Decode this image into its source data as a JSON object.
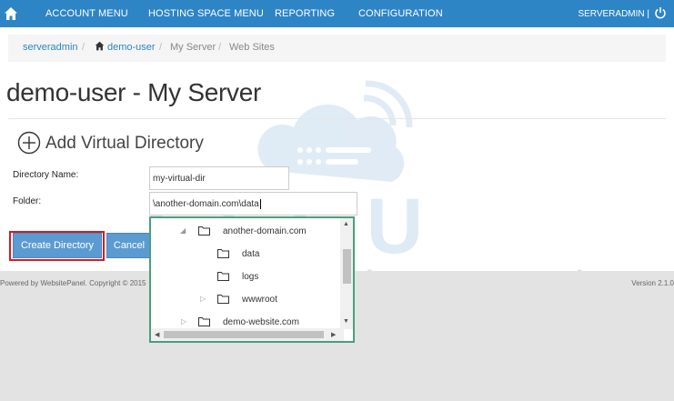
{
  "topnav": {
    "items": [
      "ACCOUNT MENU",
      "HOSTING SPACE MENU",
      "REPORTING",
      "CONFIGURATION"
    ],
    "user": "SERVERADMIN |"
  },
  "breadcrumb": {
    "root": "serveradmin",
    "user": "demo-user",
    "server": "My Server",
    "current": "Web Sites"
  },
  "page": {
    "title": "demo-user - My Server",
    "section": "Add Virtual Directory"
  },
  "form": {
    "dir_label": "Directory Name:",
    "dir_value": "my-virtual-dir",
    "folder_label": "Folder:",
    "folder_value": "\\another-domain.com\\data"
  },
  "buttons": {
    "create": "Create Directory",
    "cancel": "Cancel"
  },
  "tree": {
    "nodes": [
      {
        "label": "another-domain.com",
        "expanded": true
      },
      {
        "label": "data"
      },
      {
        "label": "logs"
      },
      {
        "label": "wwwroot",
        "expandable": true
      },
      {
        "label": "demo-website.com",
        "expandable": true
      }
    ]
  },
  "footer": {
    "powered": "Powered by WebsitePanel. Copyright © 2015",
    "version": "Version 2.1.0"
  },
  "watermark": {
    "brand": "SECU",
    "tagline": "web hosting"
  },
  "colors": {
    "nav": "#2d85c6",
    "button": "#5b9bd1",
    "highlight": "#d41c22",
    "tree_border": "#47a07c"
  }
}
